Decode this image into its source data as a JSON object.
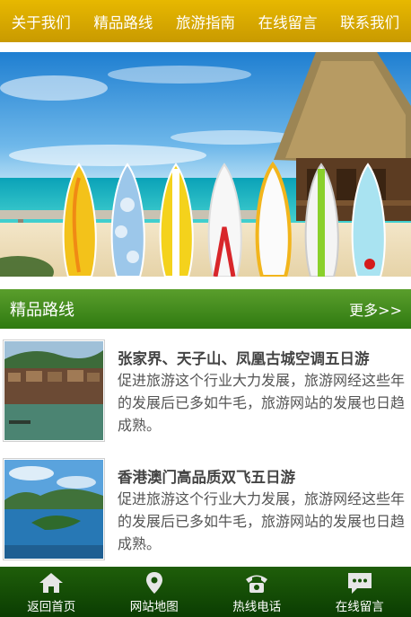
{
  "top_nav": {
    "items": [
      "关于我们",
      "精品路线",
      "旅游指南",
      "在线留言",
      "联系我们"
    ]
  },
  "banner": {
    "description": "beach-surfboards-banner"
  },
  "section": {
    "title": "精品路线",
    "more_label": "更多>>"
  },
  "routes": [
    {
      "title": "张家界、天子山、凤凰古城空调五日游",
      "desc": "促进旅游这个行业大力发展，旅游网经这些年的发展后已多如牛毛，旅游网站的发展也日趋成熟。",
      "image": "ancient-town-riverside"
    },
    {
      "title": "香港澳门高品质双飞五日游",
      "desc": "促进旅游这个行业大力发展，旅游网经这些年的发展后已多如牛毛，旅游网站的发展也日趋成熟。",
      "image": "island-bay-view"
    }
  ],
  "bottom_nav": {
    "items": [
      {
        "label": "返回首页",
        "icon": "home-icon"
      },
      {
        "label": "网站地图",
        "icon": "map-pin-icon"
      },
      {
        "label": "热线电话",
        "icon": "phone-icon"
      },
      {
        "label": "在线留言",
        "icon": "message-icon"
      }
    ]
  },
  "colors": {
    "top_nav": "#d9aa00",
    "section_bar": "#3f8a1b",
    "bottom_nav": "#155005"
  }
}
